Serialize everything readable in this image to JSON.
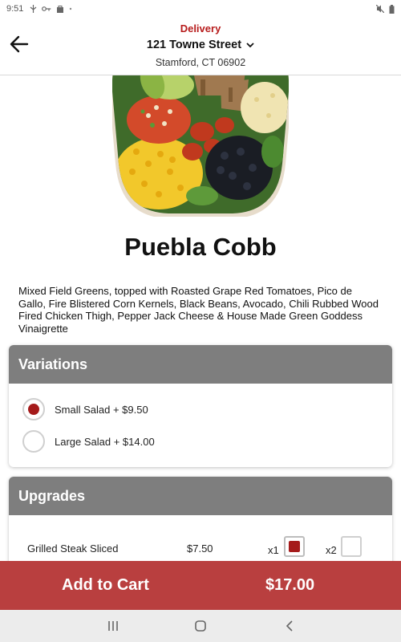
{
  "status_bar": {
    "time": "9:51",
    "icons": [
      "usb-icon",
      "key-icon",
      "bag-icon",
      "dot-icon"
    ],
    "right_icons": [
      "mute-icon",
      "battery-icon"
    ]
  },
  "header": {
    "mode": "Delivery",
    "street": "121 Towne Street",
    "city": "Stamford, CT 06902"
  },
  "item": {
    "name": "Puebla Cobb",
    "description": "Mixed Field Greens, topped with Roasted Grape Red Tomatoes, Pico de Gallo, Fire Blistered Corn Kernels, Black Beans, Avocado, Chili Rubbed Wood Fired Chicken Thigh, Pepper Jack Cheese & House Made Green Goddess Vinaigrette"
  },
  "variations": {
    "title": "Variations",
    "options": [
      {
        "label": "Small Salad + $9.50",
        "selected": true
      },
      {
        "label": "Large Salad + $14.00",
        "selected": false
      }
    ]
  },
  "upgrades": {
    "title": "Upgrades",
    "items": [
      {
        "name": "Grilled Steak Sliced",
        "price": "$7.50",
        "x1_label": "x1",
        "x1_checked": true,
        "x2_label": "x2",
        "x2_checked": false
      }
    ]
  },
  "cart": {
    "label": "Add to Cart",
    "total": "$17.00"
  },
  "colors": {
    "accent": "#b71c1c",
    "cart_bar": "#b93f3f",
    "section_header": "#7e7e7e"
  }
}
